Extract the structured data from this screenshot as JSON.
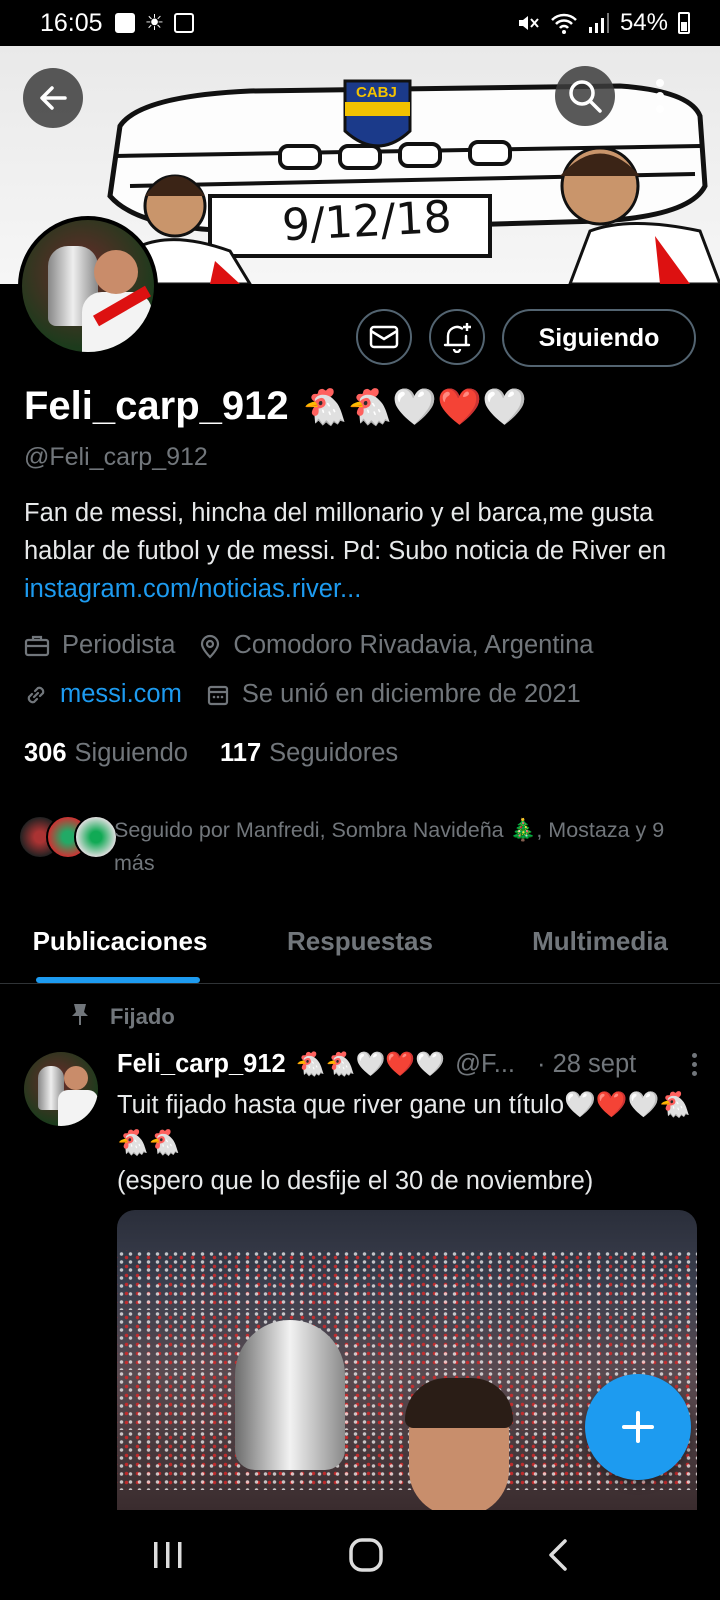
{
  "status_bar": {
    "time": "16:05",
    "battery": "54%",
    "left_icons": [
      "gallery-icon",
      "brightness-icon",
      "timer-icon"
    ],
    "right_icons": [
      "mute-icon",
      "wifi-icon",
      "signal-icon",
      "battery-icon"
    ]
  },
  "banner": {
    "date_text": "9/12/18",
    "badge_text": "CABJ"
  },
  "profile": {
    "name": "Feli_carp_912",
    "name_emojis": "🐔🐔🤍❤️🤍",
    "handle": "@Feli_carp_912",
    "bio_text": "Fan de messi, hincha del millonario y el barca,me gusta hablar de futbol y de messi. Pd: Subo noticia de River en ",
    "bio_link": "instagram.com/noticias.river...",
    "profession": "Periodista",
    "location": "Comodoro Rivadavia, Argentina",
    "website": "messi.com",
    "joined": "Se unió en diciembre de 2021",
    "following_count": "306",
    "following_label": "Siguiendo",
    "followers_count": "117",
    "followers_label": "Seguidores",
    "followed_by": "Seguido por Manfredi, Sombra Navideña 🎄, Mostaza y 9 más"
  },
  "actions": {
    "follow_label": "Siguiendo"
  },
  "tabs": [
    {
      "label": "Publicaciones",
      "active": true
    },
    {
      "label": "Respuestas",
      "active": false
    },
    {
      "label": "Multimedia",
      "active": false
    }
  ],
  "post": {
    "pinned_label": "Fijado",
    "author": "Feli_carp_912",
    "author_emojis": "🐔🐔🤍❤️🤍",
    "handle": "@F...",
    "date": "· 28 sept",
    "text_line1": "Tuit fijado hasta que river gane un título🤍❤️🤍🐔🐔🐔",
    "text_line2": "(espero que lo desfije el 30 de noviembre)"
  },
  "colors": {
    "accent": "#1d9bf0",
    "muted": "#71767b",
    "background": "#000000"
  }
}
